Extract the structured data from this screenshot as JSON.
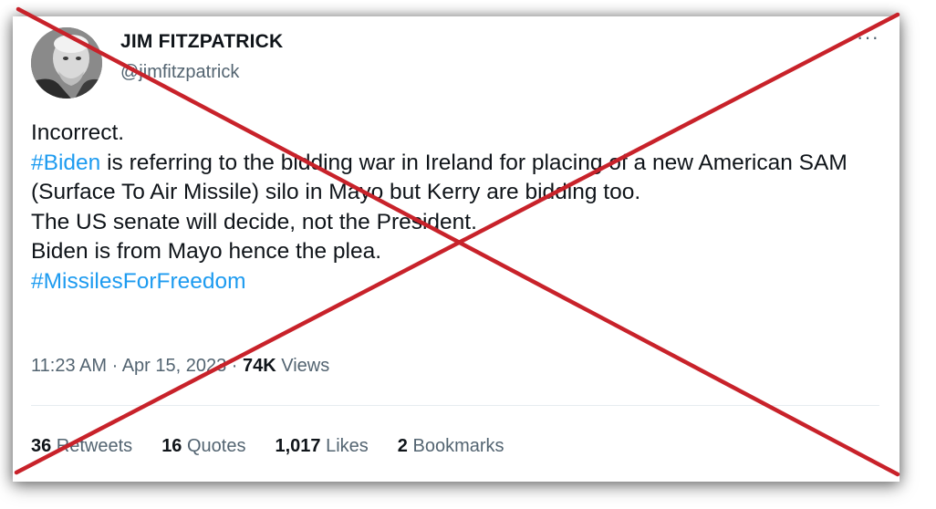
{
  "tweet": {
    "author_name": "JIM FITZPATRICK",
    "author_handle": "@jimfitzpatrick",
    "more_label": "···",
    "lines": [
      {
        "text": "Incorrect.",
        "hashtag": null
      },
      {
        "hashtag": "#Biden",
        "text": " is referring to the bidding war in Ireland for  placing of a new American SAM (Surface To Air Missile) silo in Mayo but Kerry are bidding too."
      },
      {
        "text": "The US senate will decide, not the President.",
        "hashtag": null
      },
      {
        "text": "Biden is from Mayo hence the plea.",
        "hashtag": null
      }
    ],
    "closing_hashtag": "#MissilesForFreedom",
    "timestamp": "11:23 AM · Apr 15, 2023 · ",
    "views_count": "74K",
    "views_label": " Views",
    "stats": [
      {
        "count": "36",
        "label": " Retweets"
      },
      {
        "count": "16",
        "label": " Quotes"
      },
      {
        "count": "1,017",
        "label": " Likes"
      },
      {
        "count": "2",
        "label": " Bookmarks"
      }
    ]
  },
  "colors": {
    "hashtag": "#1d9bf0",
    "text_primary": "#0f1419",
    "text_secondary": "#536471",
    "cross": "#c8222a"
  },
  "icons": {
    "more": "more-dots-icon",
    "cross_overlay": "red-x-icon"
  }
}
